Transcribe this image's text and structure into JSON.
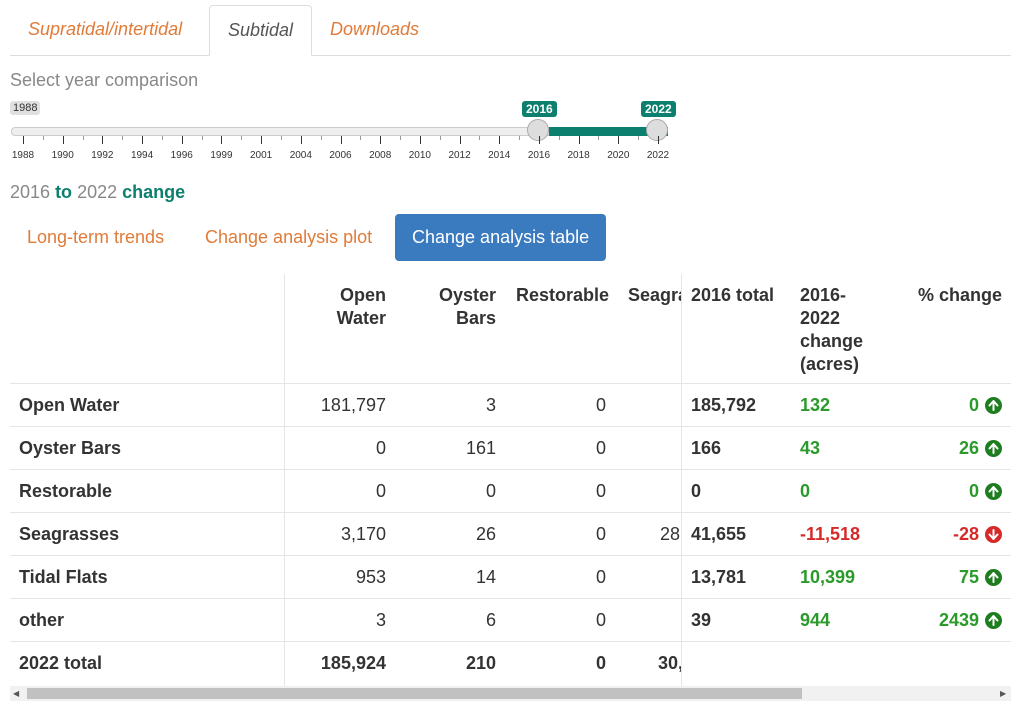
{
  "tabs": [
    "Supratidal/intertidal",
    "Subtidal",
    "Downloads"
  ],
  "select_label": "Select year comparison",
  "slider": {
    "min_label": "1988",
    "from": "2016",
    "to": "2022",
    "ticks": [
      "1988",
      "1990",
      "1992",
      "1994",
      "1996",
      "1999",
      "2001",
      "2004",
      "2006",
      "2008",
      "2010",
      "2012",
      "2014",
      "2016",
      "2018",
      "2020",
      "2022"
    ]
  },
  "change": {
    "from": "2016",
    "to_word": "to",
    "to": "2022",
    "change_word": "change"
  },
  "subtabs": [
    "Long-term trends",
    "Change analysis plot",
    "Change analysis table"
  ],
  "table": {
    "headers": [
      "Open Water",
      "Oyster Bars",
      "Restorable",
      "Seagra",
      "2016 total",
      "2016-2022 change (acres)",
      "% change"
    ],
    "rows": [
      {
        "name": "Open Water",
        "ow": "181,797",
        "ob": "3",
        "rest": "0",
        "sea": "",
        "total": "185,792",
        "chg": "132",
        "pct": "0",
        "dir": "up"
      },
      {
        "name": "Oyster Bars",
        "ow": "0",
        "ob": "161",
        "rest": "0",
        "sea": "",
        "total": "166",
        "chg": "43",
        "pct": "26",
        "dir": "up"
      },
      {
        "name": "Restorable",
        "ow": "0",
        "ob": "0",
        "rest": "0",
        "sea": "",
        "total": "0",
        "chg": "0",
        "pct": "0",
        "dir": "up"
      },
      {
        "name": "Seagrasses",
        "ow": "3,170",
        "ob": "26",
        "rest": "0",
        "sea": "28",
        "total": "41,655",
        "chg": "-11,518",
        "pct": "-28",
        "dir": "down"
      },
      {
        "name": "Tidal Flats",
        "ow": "953",
        "ob": "14",
        "rest": "0",
        "sea": "",
        "total": "13,781",
        "chg": "10,399",
        "pct": "75",
        "dir": "up"
      },
      {
        "name": "other",
        "ow": "3",
        "ob": "6",
        "rest": "0",
        "sea": "",
        "total": "39",
        "chg": "944",
        "pct": "2439",
        "dir": "up"
      }
    ],
    "total_row": {
      "name": "2022 total",
      "ow": "185,924",
      "ob": "210",
      "rest": "0",
      "sea": "30,"
    }
  },
  "colors": {
    "accent": "#e07b39",
    "teal": "#0d7f6e",
    "button": "#3a7abf",
    "positive": "#2a9a2a",
    "negative": "#d62a2a"
  }
}
